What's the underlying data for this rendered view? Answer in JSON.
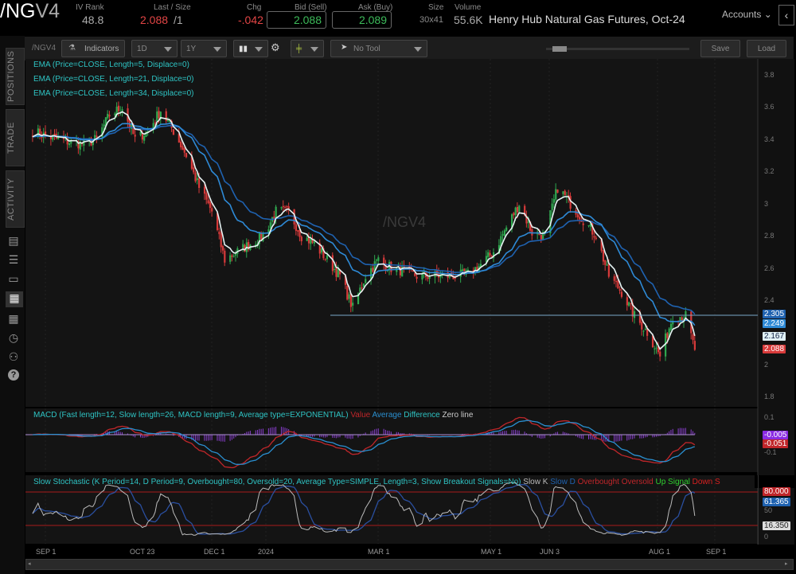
{
  "header": {
    "symbol_main": "/NG",
    "symbol_suffix": "V4",
    "iv_rank_label": "IV Rank",
    "iv_rank": "48.8",
    "last_size_label": "Last / Size",
    "last": "2.088",
    "size": "/1",
    "chg_label": "Chg",
    "chg": "-.042",
    "bid_label": "Bid (Sell)",
    "bid": "2.088",
    "ask_label": "Ask (Buy)",
    "ask": "2.089",
    "size_label": "Size",
    "size_value": "30x41",
    "volume_label": "Volume",
    "volume": "55.6K",
    "description": "Henry Hub Natural Gas Futures, Oct-24",
    "accounts_label": "Accounts",
    "collapse_icon": "chevron-left-icon"
  },
  "sidebar": {
    "tabs": [
      "POSITIONS",
      "TRADE",
      "ACTIVITY"
    ],
    "icons": [
      "news-icon",
      "list-icon",
      "tv-icon",
      "chart-icon",
      "grid-icon",
      "clock-icon",
      "people-icon",
      "help-icon"
    ]
  },
  "toolbar": {
    "symbol": "/NGV4",
    "indicators": "Indicators",
    "aggregation": "1D",
    "period": "1Y",
    "tool": "No Tool",
    "save": "Save",
    "load": "Load"
  },
  "colors": {
    "up": "#2fa84f",
    "down": "#d83a3a",
    "ema5": "#e6f2f2",
    "ema21": "#2e8ad6",
    "ema34": "#1f62b0",
    "legend": "#2ec4c4",
    "macd_value": "#c0262a",
    "macd_avg": "#2a8fd0",
    "macd_diff": "#8a3fd0"
  },
  "chart_data": {
    "type": "candlestick",
    "watermark": "/NGV4",
    "price_axis": {
      "ticks": [
        3.8,
        3.6,
        3.4,
        3.2,
        3.0,
        2.8,
        2.6,
        2.4,
        2.0,
        1.8
      ],
      "range": [
        1.75,
        3.85
      ]
    },
    "x_ticks": [
      "SEP 1",
      "OCT 23",
      "DEC 1",
      "2024",
      "MAR 1",
      "MAY 1",
      "JUN 3",
      "AUG 1",
      "SEP 1"
    ],
    "weekly_close": {
      "dates": [
        "2023-08-25",
        "2023-09-01",
        "2023-09-08",
        "2023-09-15",
        "2023-09-22",
        "2023-09-29",
        "2023-10-06",
        "2023-10-13",
        "2023-10-20",
        "2023-10-27",
        "2023-11-03",
        "2023-11-10",
        "2023-11-17",
        "2023-11-24",
        "2023-12-01",
        "2023-12-08",
        "2023-12-15",
        "2023-12-22",
        "2023-12-29",
        "2024-01-05",
        "2024-01-12",
        "2024-01-19",
        "2024-01-26",
        "2024-02-02",
        "2024-02-09",
        "2024-02-16",
        "2024-02-23",
        "2024-03-01",
        "2024-03-08",
        "2024-03-15",
        "2024-03-22",
        "2024-03-29",
        "2024-04-05",
        "2024-04-12",
        "2024-04-19",
        "2024-04-26",
        "2024-05-03",
        "2024-05-10",
        "2024-05-17",
        "2024-05-24",
        "2024-05-31",
        "2024-06-07",
        "2024-06-14",
        "2024-06-21",
        "2024-06-28",
        "2024-07-05",
        "2024-07-12",
        "2024-07-19",
        "2024-07-26",
        "2024-08-02",
        "2024-08-09",
        "2024-08-16",
        "2024-08-21"
      ],
      "close": [
        3.45,
        3.42,
        3.4,
        3.38,
        3.37,
        3.4,
        3.55,
        3.6,
        3.4,
        3.45,
        3.58,
        3.45,
        3.3,
        3.1,
        2.95,
        2.65,
        2.7,
        2.75,
        2.8,
        2.95,
        2.95,
        2.8,
        2.75,
        2.65,
        2.55,
        2.35,
        2.55,
        2.65,
        2.6,
        2.58,
        2.55,
        2.55,
        2.55,
        2.55,
        2.56,
        2.62,
        2.7,
        2.85,
        3.0,
        2.82,
        2.8,
        3.1,
        3.0,
        2.9,
        2.8,
        2.55,
        2.45,
        2.3,
        2.2,
        2.05,
        2.3,
        2.3,
        2.09
      ]
    },
    "horizontal_line": 2.305,
    "price_markers": [
      {
        "value": "2.305",
        "color": "#1f62b0"
      },
      {
        "value": "2.249",
        "color": "#2e8ad6"
      },
      {
        "value": "2.167",
        "color": "#dff0f5"
      },
      {
        "value": "2.088",
        "color": "#d83a3a"
      }
    ],
    "indicators": {
      "ema": [
        "EMA (Price=CLOSE, Length=5, Displace=0)",
        "EMA (Price=CLOSE, Length=21, Displace=0)",
        "EMA (Price=CLOSE, Length=34, Displace=0)"
      ],
      "macd": {
        "title": "MACD (Fast length=12, Slow length=26, MACD length=9, Average type=EXPONENTIAL)",
        "labels": [
          "Value",
          "Average",
          "Difference",
          "Zero line"
        ],
        "ticks": [
          "0.1",
          "-0.1"
        ],
        "markers": [
          {
            "value": "-0.005",
            "color": "#8a2be2"
          },
          {
            "value": "-0.051",
            "color": "#c0262a"
          }
        ]
      },
      "stochastic": {
        "title": "Slow Stochastic (K Period=14, D Period=9, Overbought=80, Oversold=20, Average Type=SIMPLE, Length=3, Show Breakout Signals=No)",
        "labels": [
          "Slow K",
          "Slow D",
          "Overbought",
          "Oversold",
          "Up Signal",
          "Down S"
        ],
        "ticks": [
          "50",
          "0"
        ],
        "overbought": 80,
        "oversold": 20,
        "markers": [
          {
            "value": "80.000",
            "color": "#c0262a"
          },
          {
            "value": "61.365",
            "color": "#1f62b0"
          },
          {
            "value": "16.350",
            "color": "#ddd"
          }
        ]
      }
    }
  }
}
